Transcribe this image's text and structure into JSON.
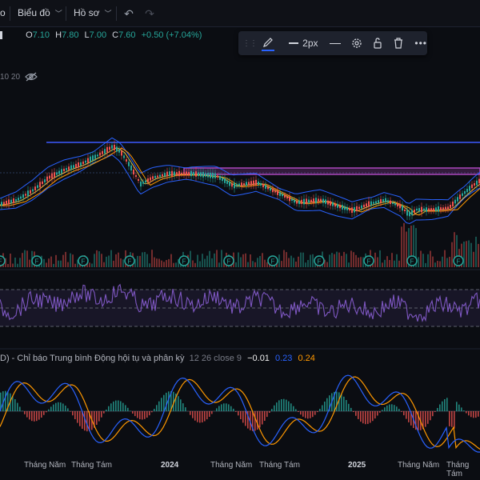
{
  "topbar": {
    "partial_left": "o",
    "chart_menu": "Biểu đồ",
    "profile_menu": "Hồ sơ"
  },
  "ohlc": {
    "o_label": "O",
    "o_value": "7.10",
    "h_label": "H",
    "h_value": "7.80",
    "l_label": "L",
    "l_value": "7.00",
    "c_label": "C",
    "c_value": "7.60",
    "change": "+0.50 (+7.04%)"
  },
  "indicator_tag": "10 20",
  "drawing_toolbar": {
    "width_label": "2px"
  },
  "macd": {
    "title": "D) - Chỉ báo Trung bình Động hội tụ và phân kỳ",
    "params": "12 26 close 9",
    "hist": "−0.01",
    "macd": "0.23",
    "signal": "0.24"
  },
  "xaxis": [
    "Tháng Năm",
    "Tháng Tám",
    "2024",
    "Tháng Năm",
    "Tháng Tám",
    "2025",
    "Tháng Năm",
    "Tháng Tám"
  ],
  "colors": {
    "up": "#26a69a",
    "down": "#ef5350",
    "macd": "#2962ff",
    "signal": "#ff9800",
    "rsi": "#7e57c2",
    "hline": "#3d5afe",
    "rect": "#ab47bc"
  },
  "icons": [
    "pencil-icon",
    "line-icon",
    "settings-icon",
    "unlock-icon",
    "trash-icon",
    "more-icon",
    "undo-icon",
    "redo-icon",
    "eye-off-icon"
  ]
}
